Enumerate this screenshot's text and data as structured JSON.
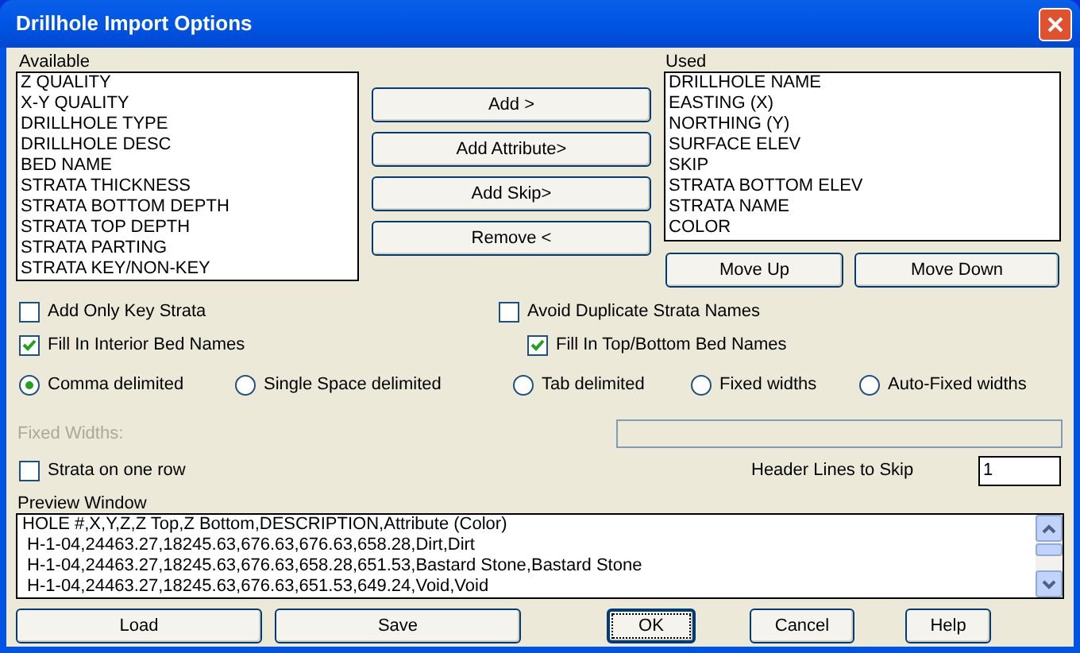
{
  "window": {
    "title": "Drillhole Import Options"
  },
  "available": {
    "label": "Available",
    "items": [
      "Z QUALITY",
      "X-Y QUALITY",
      "DRILLHOLE TYPE",
      "DRILLHOLE DESC",
      "BED NAME",
      "STRATA THICKNESS",
      "STRATA BOTTOM DEPTH",
      "STRATA TOP DEPTH",
      "STRATA PARTING",
      "STRATA KEY/NON-KEY"
    ]
  },
  "transfer_buttons": [
    "Add >",
    "Add Attribute>",
    "Add Skip>",
    "Remove <"
  ],
  "used": {
    "label": "Used",
    "items": [
      "DRILLHOLE NAME",
      "EASTING (X)",
      "NORTHING (Y)",
      "SURFACE ELEV",
      "SKIP",
      "STRATA BOTTOM ELEV",
      "STRATA NAME",
      "COLOR"
    ]
  },
  "order_buttons": [
    "Move Up",
    "Move Down"
  ],
  "checkboxes": [
    {
      "label": "Add Only Key Strata",
      "checked": false
    },
    {
      "label": "Avoid Duplicate Strata Names",
      "checked": false
    },
    {
      "label": "Fill In Interior Bed Names",
      "checked": true
    },
    {
      "label": "Fill In Top/Bottom Bed Names",
      "checked": true
    }
  ],
  "delimiters": [
    {
      "label": "Comma delimited",
      "selected": true
    },
    {
      "label": "Single Space delimited",
      "selected": false
    },
    {
      "label": "Tab delimited",
      "selected": false
    },
    {
      "label": "Fixed widths",
      "selected": false
    },
    {
      "label": "Auto-Fixed widths",
      "selected": false
    }
  ],
  "fixed_widths": {
    "label": "Fixed Widths:",
    "disabled": true
  },
  "strata_on_one_row": {
    "label": "Strata on one row",
    "checked": false
  },
  "header_lines": {
    "label": "Header Lines to Skip",
    "value": "1"
  },
  "preview": {
    "label": "Preview Window",
    "lines": [
      "HOLE #,X,Y,Z,Z Top,Z Bottom,DESCRIPTION,Attribute (Color)",
      " H-1-04,24463.27,18245.63,676.63,676.63,658.28,Dirt,Dirt",
      " H-1-04,24463.27,18245.63,676.63,658.28,651.53,Bastard Stone,Bastard Stone",
      " H-1-04,24463.27,18245.63,676.63,651.53,649.24,Void,Void"
    ]
  },
  "buttons": [
    {
      "label": "Load",
      "default": false
    },
    {
      "label": "Save",
      "default": false
    },
    {
      "label": "OK",
      "default": true
    },
    {
      "label": "Cancel",
      "default": false
    },
    {
      "label": "Help",
      "default": false
    }
  ]
}
